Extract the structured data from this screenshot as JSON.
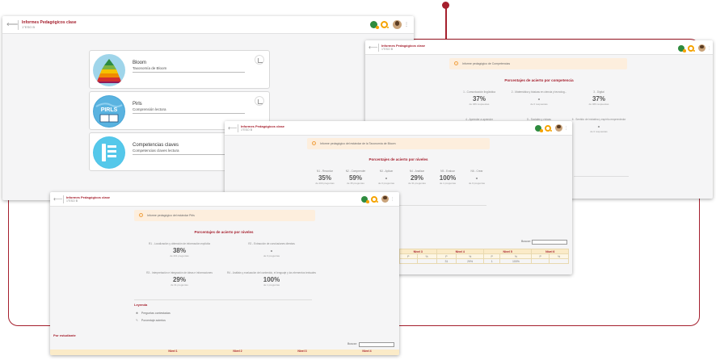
{
  "header": {
    "title": "Informes Pedagógicos clase",
    "subtitle": "1°ESO B"
  },
  "window1": {
    "cards": [
      {
        "name": "Bloom",
        "sub": "Taxonomía de Bloom"
      },
      {
        "name": "Pirls",
        "sub": "Comprensión lectora",
        "thumb_text": "PIRLS"
      },
      {
        "name": "Competencias claves",
        "sub": "Competencias claves lectura"
      }
    ]
  },
  "window2": {
    "banner": "Informe pedagógico de Competencias",
    "section": "Porcentajes de acierto por competencia",
    "stats": [
      {
        "label": "1 - Comunicación lingüística",
        "value": "37%",
        "sub": "de 466 respuestas"
      },
      {
        "label": "2 - Matemática y básicas en ciencia y tecnolog...",
        "value": "-",
        "sub": "de 0 respuestas"
      },
      {
        "label": "3 - Digital",
        "value": "37%",
        "sub": "de 466 respuestas"
      },
      {
        "label": "4 - Aprender a aprender",
        "value": "",
        "sub": ""
      },
      {
        "label": "5 - Sociales y cívicas",
        "value": "",
        "sub": ""
      },
      {
        "label": "6 - Sentido de iniciativa y espíritu emprendedor",
        "value": "-",
        "sub": "de 0 respuestas"
      }
    ]
  },
  "window3": {
    "banner": "Informe pedagógico del estándar de la Taxonomía de Bloom",
    "section": "Porcentajes de acierto por niveles",
    "stats": [
      {
        "label": "N1 - Recordar",
        "value": "35%",
        "sub": "de 200 preguntas"
      },
      {
        "label": "N2 - Comprender",
        "value": "59%",
        "sub": "de 35 preguntas"
      },
      {
        "label": "N3 - Aplicar",
        "value": "-",
        "sub": "de 0 preguntas"
      },
      {
        "label": "N4 - Analizar",
        "value": "29%",
        "sub": "de 31 preguntas"
      },
      {
        "label": "N5 - Evaluar",
        "value": "100%",
        "sub": "de 1 preguntas"
      },
      {
        "label": "N6 - Crear",
        "value": "-",
        "sub": "de 0 preguntas"
      }
    ],
    "search_label": "Buscar:",
    "table": {
      "headers": [
        "Nivel 3",
        "Nivel 4",
        "Nivel 5",
        "Nivel 6"
      ],
      "sub": [
        "P",
        "%",
        "P",
        "%",
        "P",
        "%",
        "P",
        "%"
      ],
      "row": [
        "",
        "",
        "31",
        "29%",
        "1",
        "100%",
        "",
        ""
      ]
    }
  },
  "window4": {
    "banner": "Informe pedagógico del estándar Pirls",
    "section": "Porcentajes de acierto por niveles",
    "stats": [
      {
        "label": "R1 - Localización y obtención de información explícita",
        "value": "38%",
        "sub": "de 201 preguntas"
      },
      {
        "label": "R2 - Extracción de conclusiones directas",
        "value": "-",
        "sub": "de 0 preguntas"
      },
      {
        "label": "R3 - Interpretación e integración de ideas e informaciones",
        "value": "29%",
        "sub": "de 31 preguntas"
      },
      {
        "label": "R4 - Análisis y evaluación del contenido, el lenguaje y los elementos textuales",
        "value": "100%",
        "sub": "de 1 preguntas"
      }
    ],
    "legend_title": "Leyenda",
    "legend": [
      "Preguntas contestadas",
      "Porcentaje aciertos"
    ],
    "by_student": "Por estudiante",
    "search_label": "Buscar:",
    "table_headers": [
      "Nivel 1",
      "Nivel 2",
      "Nivel 3",
      "Nivel 4"
    ]
  }
}
